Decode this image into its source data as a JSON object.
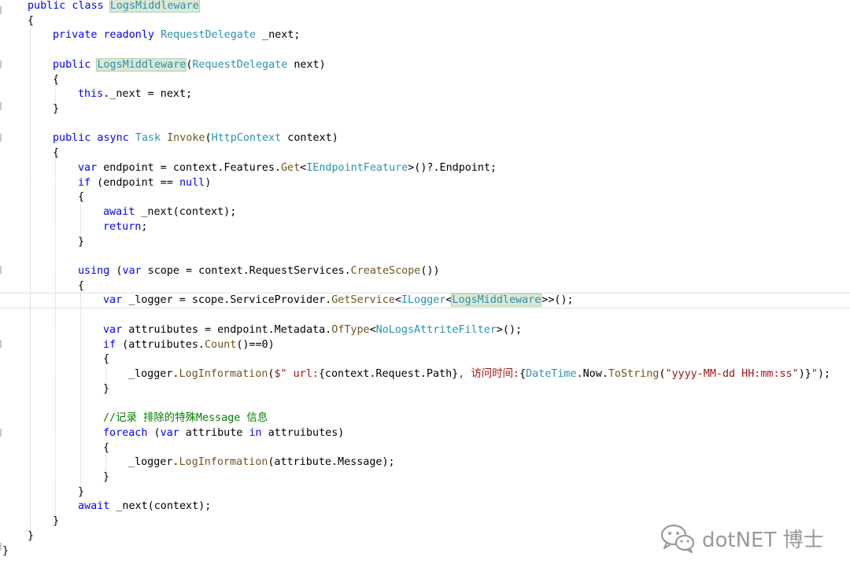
{
  "code_lines": [
    [
      {
        "t": "public class ",
        "c": "kw"
      },
      {
        "t": "LogsMiddleware",
        "c": "ty",
        "hl": true
      }
    ],
    [
      {
        "t": "{",
        "c": "pl"
      }
    ],
    [
      {
        "t": "private readonly ",
        "c": "kw"
      },
      {
        "t": "RequestDelegate",
        "c": "ty"
      },
      {
        "t": " _next;",
        "c": "pl"
      }
    ],
    [],
    [
      {
        "t": "public ",
        "c": "kw"
      },
      {
        "t": "LogsMiddleware",
        "c": "ty",
        "hl": true
      },
      {
        "t": "(",
        "c": "pl"
      },
      {
        "t": "RequestDelegate",
        "c": "ty"
      },
      {
        "t": " next)",
        "c": "pl"
      }
    ],
    [
      {
        "t": "{",
        "c": "pl"
      }
    ],
    [
      {
        "t": "this",
        "c": "kw"
      },
      {
        "t": "._next = next;",
        "c": "pl"
      }
    ],
    [
      {
        "t": "}",
        "c": "pl"
      }
    ],
    [],
    [
      {
        "t": "public async ",
        "c": "kw"
      },
      {
        "t": "Task",
        "c": "ty"
      },
      {
        "t": " ",
        "c": "pl"
      },
      {
        "t": "Invoke",
        "c": "mt"
      },
      {
        "t": "(",
        "c": "pl"
      },
      {
        "t": "HttpContext",
        "c": "ty"
      },
      {
        "t": " context)",
        "c": "pl"
      }
    ],
    [
      {
        "t": "{",
        "c": "pl"
      }
    ],
    [
      {
        "t": "var",
        "c": "kw"
      },
      {
        "t": " endpoint = context.Features.",
        "c": "pl"
      },
      {
        "t": "Get",
        "c": "mt"
      },
      {
        "t": "<",
        "c": "pl"
      },
      {
        "t": "IEndpointFeature",
        "c": "ty"
      },
      {
        "t": ">()?.Endpoint;",
        "c": "pl"
      }
    ],
    [
      {
        "t": "if",
        "c": "kw"
      },
      {
        "t": " (endpoint == ",
        "c": "pl"
      },
      {
        "t": "null",
        "c": "kw"
      },
      {
        "t": ")",
        "c": "pl"
      }
    ],
    [
      {
        "t": "{",
        "c": "pl"
      }
    ],
    [
      {
        "t": "await",
        "c": "kw"
      },
      {
        "t": " _next(context);",
        "c": "pl"
      }
    ],
    [
      {
        "t": "return",
        "c": "kw"
      },
      {
        "t": ";",
        "c": "pl"
      }
    ],
    [
      {
        "t": "}",
        "c": "pl"
      }
    ],
    [],
    [
      {
        "t": "using",
        "c": "kw"
      },
      {
        "t": " (",
        "c": "pl"
      },
      {
        "t": "var",
        "c": "kw"
      },
      {
        "t": " scope = context.RequestServices.",
        "c": "pl"
      },
      {
        "t": "CreateScope",
        "c": "mt"
      },
      {
        "t": "())",
        "c": "pl"
      }
    ],
    [
      {
        "t": "{",
        "c": "pl"
      }
    ],
    [
      {
        "t": "var",
        "c": "kw"
      },
      {
        "t": " _logger = scope.ServiceProvider.",
        "c": "pl"
      },
      {
        "t": "GetService",
        "c": "mt"
      },
      {
        "t": "<",
        "c": "pl"
      },
      {
        "t": "ILogger",
        "c": "ty"
      },
      {
        "t": "<",
        "c": "pl"
      },
      {
        "t": "LogsMiddleware",
        "c": "ty",
        "hl": true
      },
      {
        "caret": true
      },
      {
        "t": ">>();",
        "c": "pl"
      }
    ],
    [],
    [
      {
        "t": "var",
        "c": "kw"
      },
      {
        "t": " attruibutes = endpoint.Metadata.",
        "c": "pl"
      },
      {
        "t": "OfType",
        "c": "mt"
      },
      {
        "t": "<",
        "c": "pl"
      },
      {
        "t": "NoLogsAttriteFilter",
        "c": "ty"
      },
      {
        "t": ">();",
        "c": "pl"
      }
    ],
    [
      {
        "t": "if",
        "c": "kw"
      },
      {
        "t": " (attruibutes.",
        "c": "pl"
      },
      {
        "t": "Count",
        "c": "mt"
      },
      {
        "t": "()==0)",
        "c": "pl"
      }
    ],
    [
      {
        "t": "{",
        "c": "pl"
      }
    ],
    [
      {
        "t": "_logger.",
        "c": "pl"
      },
      {
        "t": "LogInformation",
        "c": "mt"
      },
      {
        "t": "(",
        "c": "pl"
      },
      {
        "t": "$\" url:",
        "c": "st"
      },
      {
        "t": "{context.Request.Path}",
        "c": "pl"
      },
      {
        "t": ", 访问时间:",
        "c": "st"
      },
      {
        "t": "{",
        "c": "pl"
      },
      {
        "t": "DateTime",
        "c": "ty"
      },
      {
        "t": ".Now.",
        "c": "pl"
      },
      {
        "t": "ToString",
        "c": "mt"
      },
      {
        "t": "(",
        "c": "pl"
      },
      {
        "t": "\"yyyy-MM-dd HH:mm:ss\"",
        "c": "st"
      },
      {
        "t": ")}",
        "c": "pl"
      },
      {
        "t": "\"",
        "c": "st"
      },
      {
        "t": ");",
        "c": "pl"
      }
    ],
    [
      {
        "t": "}",
        "c": "pl"
      }
    ],
    [],
    [
      {
        "t": "//记录 排除的特殊Message 信息",
        "c": "cm"
      }
    ],
    [
      {
        "t": "foreach",
        "c": "kw"
      },
      {
        "t": " (",
        "c": "pl"
      },
      {
        "t": "var",
        "c": "kw"
      },
      {
        "t": " attribute ",
        "c": "pl"
      },
      {
        "t": "in",
        "c": "kw"
      },
      {
        "t": " attruibutes)",
        "c": "pl"
      }
    ],
    [
      {
        "t": "{",
        "c": "pl"
      }
    ],
    [
      {
        "t": "_logger.",
        "c": "pl"
      },
      {
        "t": "LogInformation",
        "c": "mt"
      },
      {
        "t": "(attribute.Message);",
        "c": "pl"
      }
    ],
    [
      {
        "t": "}",
        "c": "pl"
      }
    ],
    [
      {
        "t": "}",
        "c": "pl"
      }
    ],
    [
      {
        "t": "await",
        "c": "kw"
      },
      {
        "t": " _next(context);",
        "c": "pl"
      }
    ],
    [
      {
        "t": "}",
        "c": "pl"
      }
    ],
    [
      {
        "t": "}",
        "c": "pl"
      }
    ],
    [
      {
        "t": "}",
        "c": "pl"
      }
    ]
  ],
  "watermark": {
    "icon": "wechat-icon",
    "text": "dotNET 博士"
  },
  "colors": {
    "keyword": "#0000ff",
    "type": "#2b91af",
    "method": "#74531f",
    "string": "#a31515",
    "comment": "#008000",
    "plain": "#000000",
    "highlight": "#dbe8d5"
  }
}
